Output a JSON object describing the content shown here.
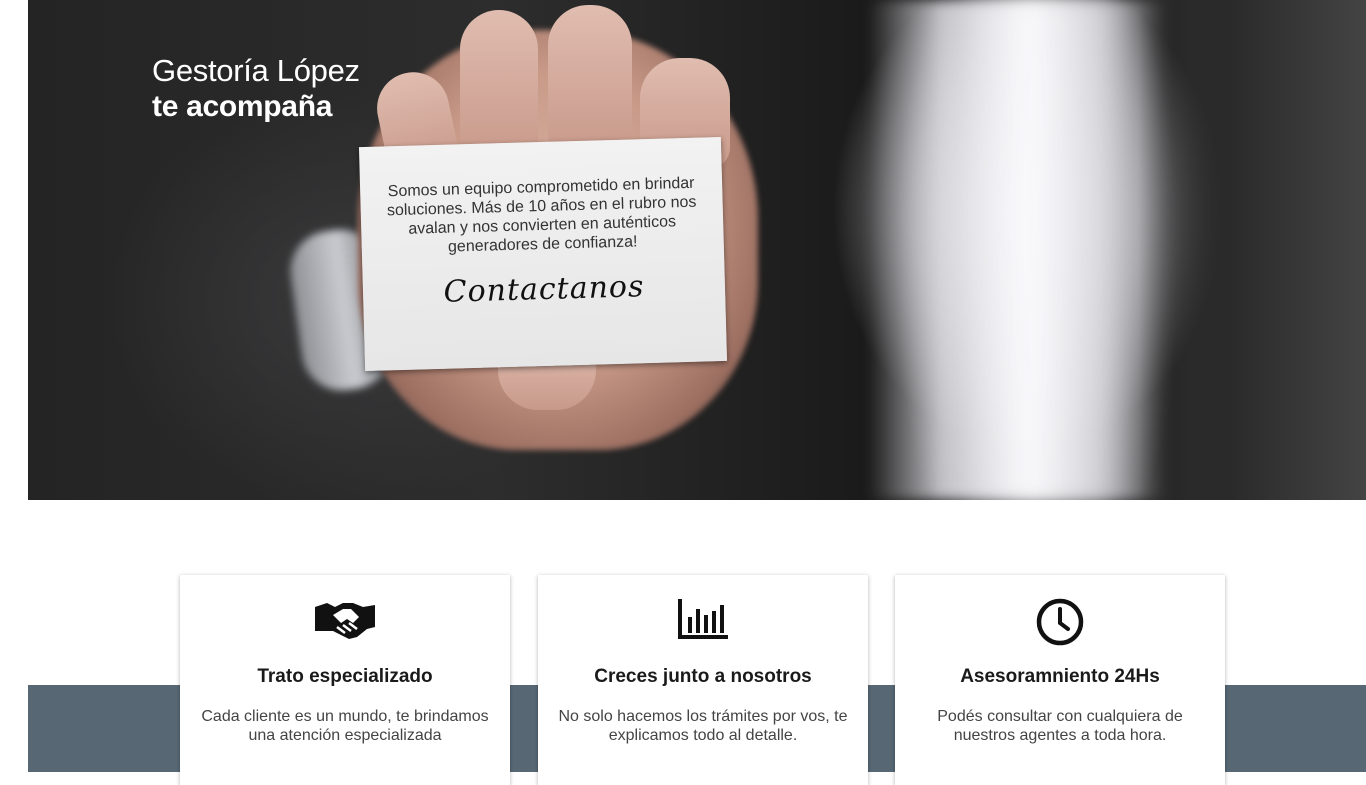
{
  "hero": {
    "brand_title": "Gestoría López",
    "brand_subtitle": "te acompaña",
    "card_text": "Somos un equipo comprometido en brindar soluciones. Más de 10 años en el rubro nos avalan y nos convierten en auténticos generadores de confianza!",
    "card_cta": "Contactanos"
  },
  "features": [
    {
      "icon": "handshake-icon",
      "title": "Trato especializado",
      "description": "Cada cliente es un mundo, te brindamos una atención especializada"
    },
    {
      "icon": "bar-chart-icon",
      "title": "Creces junto a nosotros",
      "description": "No solo hacemos los trámites por vos, te explicamos todo al detalle."
    },
    {
      "icon": "clock-icon",
      "title": "Asesoramniento 24Hs",
      "description": "Podés consultar con cualquiera de nuestros agentes a toda hora."
    }
  ],
  "colors": {
    "band": "#576874",
    "hero_dark": "#222222",
    "card": "#eeeeee"
  }
}
